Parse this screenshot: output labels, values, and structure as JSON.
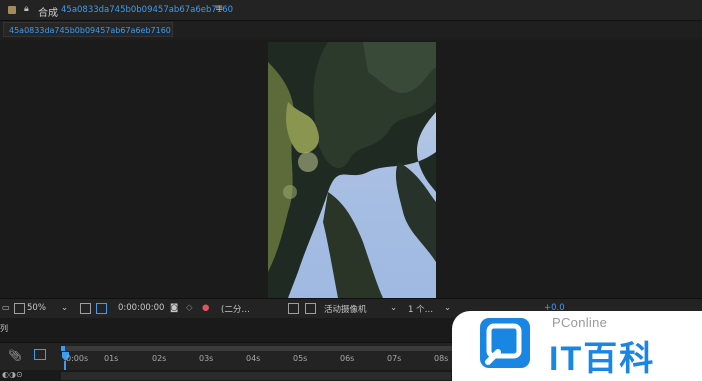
{
  "panel": {
    "label": "合成",
    "comp_name": "45a0833da745b0b09457ab67a6eb7160",
    "menu_icon": "≡"
  },
  "tab": {
    "label": "45a0833da745b0b09457ab67a6eb7160"
  },
  "toolbar": {
    "zoom": "50%",
    "timecode": "0:00:00:00",
    "resolution": "(二分…",
    "camera": "活动摄像机",
    "views": "1 个…",
    "exposure": "+0.0",
    "dropdown_caret": "⌄"
  },
  "timeline": {
    "side_label": "列",
    "ticks": [
      "0:00s",
      "01s",
      "02s",
      "03s",
      "04s",
      "05s",
      "06s",
      "07s",
      "08s"
    ]
  },
  "watermark": {
    "brand_small": "PConline",
    "brand_large": "IT百科"
  },
  "colors": {
    "accent": "#3e9cf0",
    "brand": "#1a86e4",
    "panel_bg": "#1d1d1d"
  }
}
